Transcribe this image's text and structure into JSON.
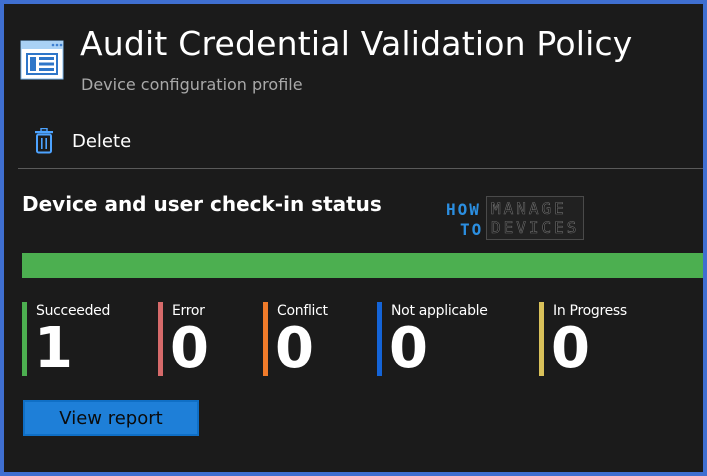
{
  "header": {
    "title": "Audit Credential Validation Policy",
    "subtitle": "Device configuration profile",
    "icon": "profile-window-icon"
  },
  "toolbar": {
    "delete_label": "Delete",
    "delete_icon": "trash-icon"
  },
  "section": {
    "title": "Device and user check-in status",
    "progress_fraction": 1.0,
    "progress_color": "#4caf50"
  },
  "watermark": {
    "how": "HOW",
    "to": "TO",
    "manage": "MANAGE",
    "devices": "DEVICES"
  },
  "stats": [
    {
      "label": "Succeeded",
      "value": "1",
      "color": "#4caf50"
    },
    {
      "label": "Error",
      "value": "0",
      "color": "#d66a6a"
    },
    {
      "label": "Conflict",
      "value": "0",
      "color": "#f07b2a"
    },
    {
      "label": "Not applicable",
      "value": "0",
      "color": "#1464d8"
    },
    {
      "label": "In Progress",
      "value": "0",
      "color": "#d9c15a"
    }
  ],
  "actions": {
    "view_report_label": "View report"
  },
  "colors": {
    "frame_border": "#3f6fd1",
    "background": "#1b1b1b",
    "accent": "#1e7fd8"
  }
}
